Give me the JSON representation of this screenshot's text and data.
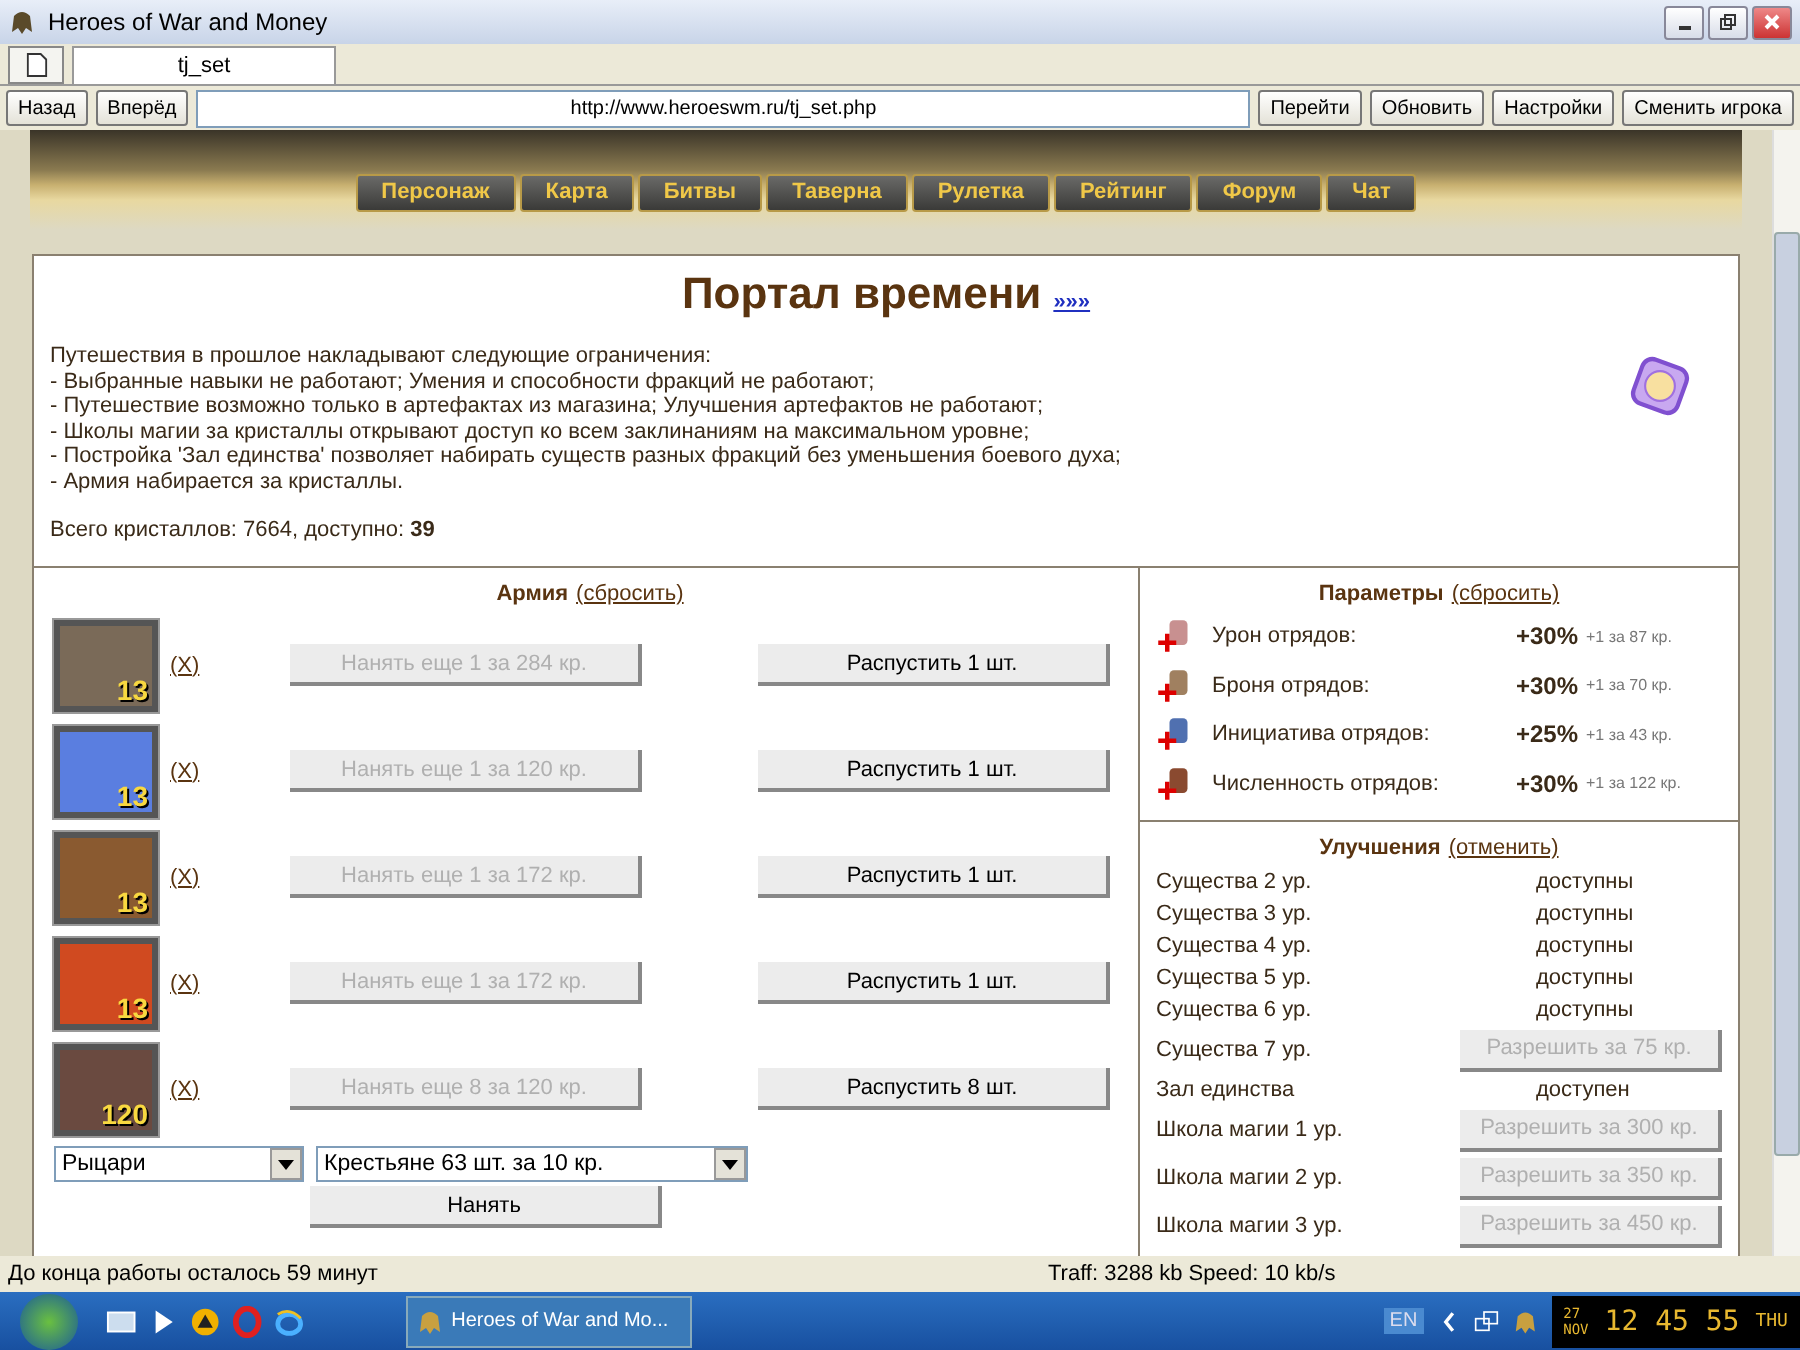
{
  "window": {
    "title": "Heroes of War and Money"
  },
  "browser": {
    "tab": "tj_set",
    "back": "Назад",
    "forward": "Вперёд",
    "url": "http://www.heroeswm.ru/tj_set.php",
    "buttons": [
      "Перейти",
      "Обновить",
      "Настройки",
      "Сменить игрока"
    ]
  },
  "nav": {
    "items": [
      "Персонаж",
      "Карта",
      "Битвы",
      "Таверна",
      "Рулетка",
      "Рейтинг",
      "Форум",
      "Чат"
    ]
  },
  "portal": {
    "title": "Портал времени",
    "more_link": "»»»",
    "intro": [
      "Путешествия в прошлое накладывают следующие ограничения:",
      "- Выбранные навыки не работают; Умения и способности фракций не работают;",
      "- Путешествие возможно только в артефактах из магазина; Улучшения артефактов не работают;",
      "- Школы магии за кристаллы открывают доступ ко всем заклинаниям на максимальном уровне;",
      "- Постройка 'Зал единства' позволяет набирать существ разных фракций без уменьшения боевого духа;",
      "- Армия набирается за кристаллы."
    ],
    "crystals": "Всего кристаллов: 7664, доступно: **39**"
  },
  "army": {
    "heading": "Армия",
    "reset": "(сбросить)",
    "units": [
      {
        "kind": "elder",
        "count": "13",
        "remove": "(X)",
        "hire": {
          "label": "Нанять еще 1 за 284 кр.",
          "disabled": true
        },
        "dismiss": {
          "label": "Распустить 1 шт.",
          "disabled": false
        }
      },
      {
        "kind": "bear",
        "count": "13",
        "remove": "(X)",
        "hire": {
          "label": "Нанять еще 1 за 120 кр.",
          "disabled": true
        },
        "dismiss": {
          "label": "Распустить 1 шт.",
          "disabled": false
        }
      },
      {
        "kind": "beast",
        "count": "13",
        "remove": "(X)",
        "hire": {
          "label": "Нанять еще 1 за 172 кр.",
          "disabled": true
        },
        "dismiss": {
          "label": "Распустить 1 шт.",
          "disabled": false
        }
      },
      {
        "kind": "demon",
        "count": "13",
        "remove": "(X)",
        "hire": {
          "label": "Нанять еще 1 за 172 кр.",
          "disabled": true
        },
        "dismiss": {
          "label": "Распустить 1 шт.",
          "disabled": false
        }
      },
      {
        "kind": "horned",
        "count": "120",
        "remove": "(X)",
        "hire": {
          "label": "Нанять еще 8 за 120 кр.",
          "disabled": true
        },
        "dismiss": {
          "label": "Распустить 8 шт.",
          "disabled": false
        }
      }
    ],
    "faction": "Рыцари",
    "creature": "Крестьяне 63 шт. за 10 кр.",
    "hire_button": "Нанять"
  },
  "params": {
    "heading": "Параметры",
    "reset": "(сбросить)",
    "items": [
      {
        "kind": "damage",
        "label": "Урон отрядов:",
        "value": "+30%",
        "cost": "+1 за 87 кр."
      },
      {
        "kind": "armor",
        "label": "Броня отрядов:",
        "value": "+30%",
        "cost": "+1 за 70 кр."
      },
      {
        "kind": "initiative",
        "label": "Инициатива отрядов:",
        "value": "+25%",
        "cost": "+1 за 43 кр."
      },
      {
        "kind": "count",
        "label": "Численность отрядов:",
        "value": "+30%",
        "cost": "+1 за 122 кр."
      }
    ]
  },
  "upgrades": {
    "heading": "Улучшения",
    "cancel": "(отменить)",
    "items": [
      {
        "label": "Существа 2 ур.",
        "kind": "status",
        "text": "доступны"
      },
      {
        "label": "Существа 3 ур.",
        "kind": "status",
        "text": "доступны"
      },
      {
        "label": "Существа 4 ур.",
        "kind": "status",
        "text": "доступны"
      },
      {
        "label": "Существа 5 ур.",
        "kind": "status",
        "text": "доступны"
      },
      {
        "label": "Существа 6 ур.",
        "kind": "status",
        "text": "доступны"
      },
      {
        "label": "Существа 7 ур.",
        "kind": "button",
        "text": "Разрешить за 75 кр.",
        "disabled": true
      },
      {
        "label": "Зал единства",
        "kind": "status",
        "text": "доступен"
      },
      {
        "label": "Школа магии 1 ур.",
        "kind": "button",
        "text": "Разрешить за 300 кр.",
        "disabled": true
      },
      {
        "label": "Школа магии 2 ур.",
        "kind": "button",
        "text": "Разрешить за 350 кр.",
        "disabled": true
      },
      {
        "label": "Школа магии 3 ур.",
        "kind": "button",
        "text": "Разрешить за 450 кр.",
        "disabled": true
      }
    ]
  },
  "status_bar": {
    "left": "До конца работы осталось 59 минут",
    "right": "Traff: 3288 kb Speed: 10 kb/s"
  },
  "taskbar": {
    "task": "Heroes of War and Mo...",
    "language": "EN",
    "clock": {
      "day": "27",
      "month": "NOV",
      "time": "12 45 55",
      "weekday": "THU"
    }
  }
}
